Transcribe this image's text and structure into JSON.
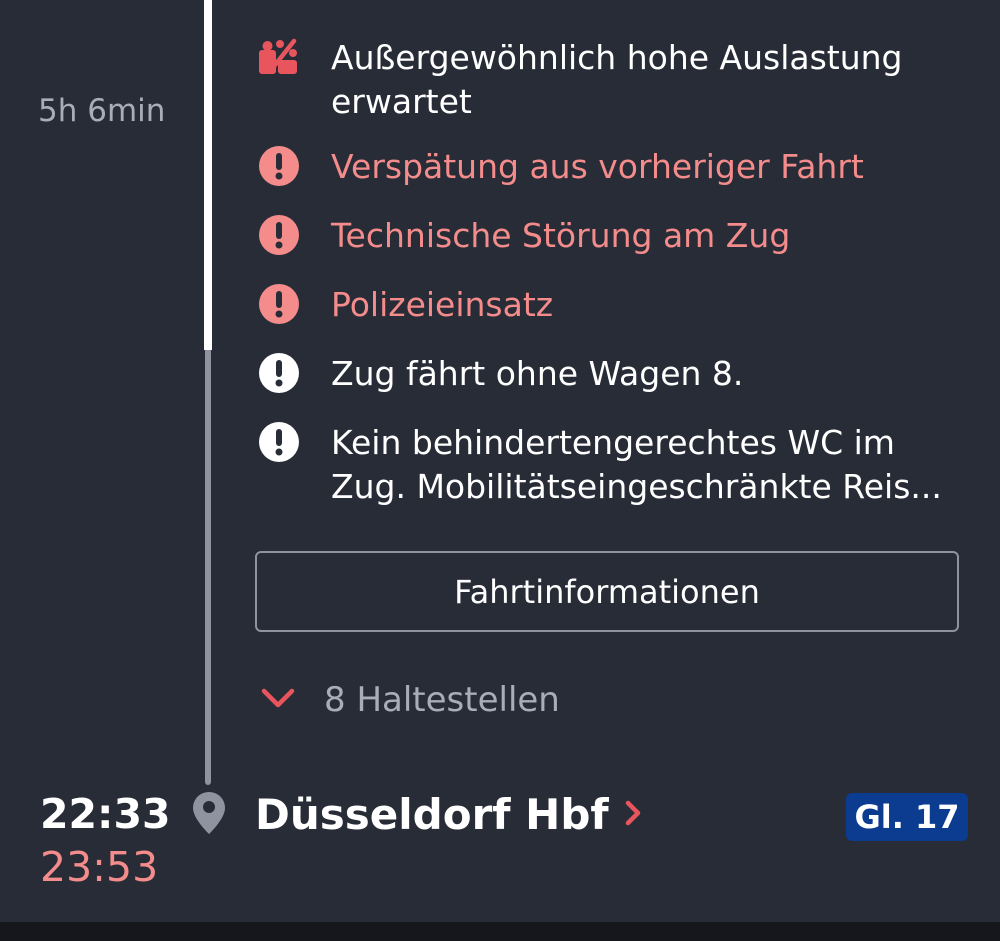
{
  "journey": {
    "duration": "5h 6min"
  },
  "messages": [
    {
      "text": "Außergewöhnlich hohe Auslastung erwartet",
      "icon": "high-occupancy-icon",
      "tone": "white"
    },
    {
      "text": "Verspätung aus vorheriger Fahrt",
      "icon": "warning-icon",
      "tone": "red"
    },
    {
      "text": "Technische Störung am Zug",
      "icon": "warning-icon",
      "tone": "red"
    },
    {
      "text": "Polizeieinsatz",
      "icon": "warning-icon",
      "tone": "red"
    },
    {
      "text": "Zug fährt ohne Wagen 8.",
      "icon": "info-icon",
      "tone": "white"
    },
    {
      "line1": "Kein behindertengerechtes WC im",
      "line2": "Zug. Mobilitätseingeschränkte Reis...",
      "icon": "info-icon",
      "tone": "white"
    }
  ],
  "trip_info_button": "Fahrtinformationen",
  "stops_toggle": "8 Haltestellen",
  "arrival": {
    "scheduled_time": "22:33",
    "actual_time": "23:53",
    "station": "Düsseldorf Hbf",
    "platform": "Gl. 17"
  },
  "colors": {
    "background": "#282c37",
    "alert_red": "#f48c8c",
    "icon_red": "#e8555d",
    "platform_blue": "#0b3c8f",
    "muted_text": "#a8adb8"
  }
}
